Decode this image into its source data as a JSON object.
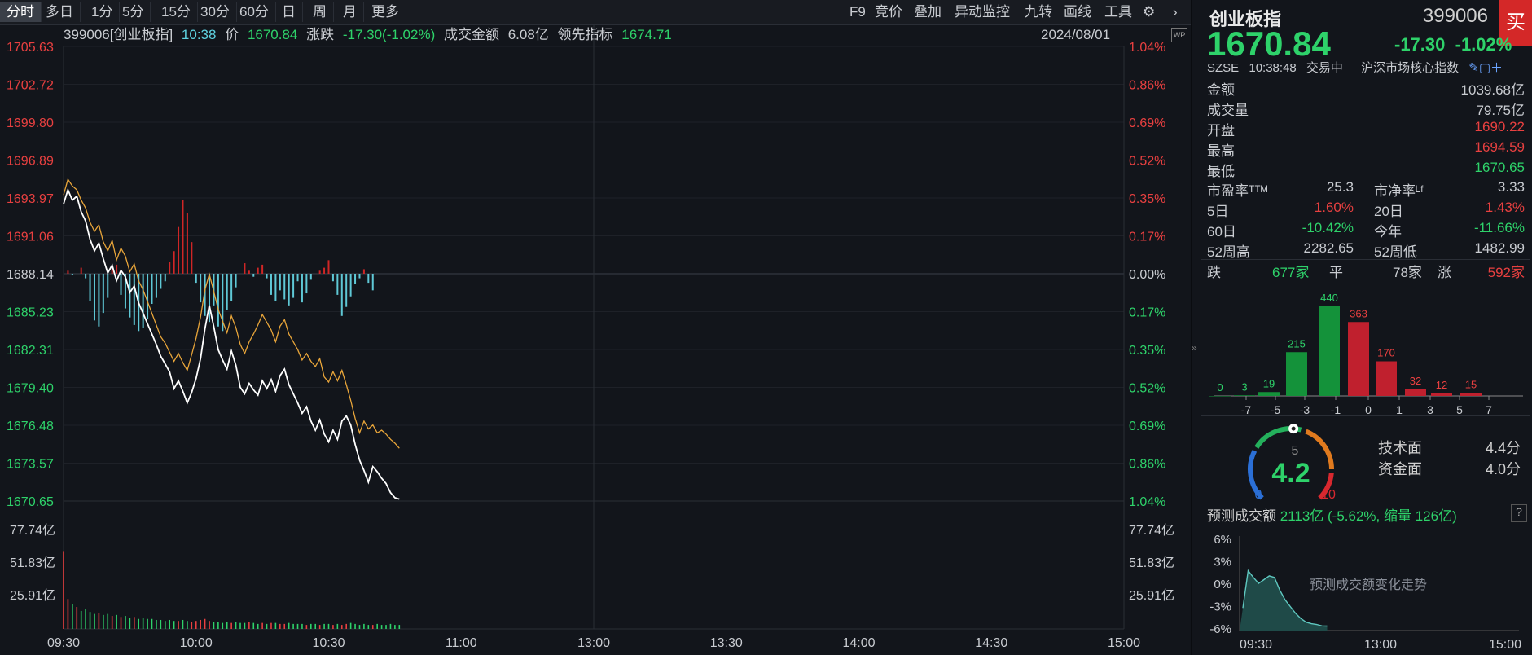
{
  "tabs": [
    "分时",
    "多日",
    "1分",
    "5分",
    "15分",
    "30分",
    "60分",
    "日",
    "周",
    "月",
    "更多"
  ],
  "tools": [
    "F9",
    "竞价",
    "叠加",
    "异动监控",
    "九转",
    "画线",
    "工具"
  ],
  "info": {
    "code": "399006[创业板指]",
    "time": "10:38",
    "price_label": "价",
    "price": "1670.84",
    "change_label": "涨跌",
    "change": "-17.30(-1.02%)",
    "amount_label": "成交金额",
    "amount": "6.08亿",
    "lead_label": "领先指标",
    "lead": "1674.71",
    "date": "2024/08/01",
    "wp_icon": "WP"
  },
  "chart_data": {
    "type": "line",
    "price_ticks": [
      "1705.63",
      "1702.72",
      "1699.80",
      "1696.89",
      "1693.97",
      "1691.06",
      "1688.14",
      "1685.23",
      "1682.31",
      "1679.40",
      "1676.48",
      "1673.57",
      "1670.65"
    ],
    "pct_ticks": [
      "1.04%",
      "0.86%",
      "0.69%",
      "0.52%",
      "0.35%",
      "0.17%",
      "0.00%",
      "0.17%",
      "0.35%",
      "0.52%",
      "0.69%",
      "0.86%",
      "1.04%"
    ],
    "vol_ticks": [
      "77.74亿",
      "51.83亿",
      "25.91亿"
    ],
    "time_ticks": [
      "09:30",
      "10:00",
      "10:30",
      "11:00",
      "13:00",
      "13:30",
      "14:00",
      "14:30",
      "15:00"
    ],
    "ylim": [
      1670.65,
      1705.63
    ],
    "prev_close": 1688.14,
    "price": [
      1693.5,
      1694.6,
      1693.8,
      1694.1,
      1692.9,
      1692.2,
      1690.8,
      1689.9,
      1690.5,
      1689.3,
      1688.2,
      1688.8,
      1687.6,
      1688.4,
      1687.9,
      1686.7,
      1687.2,
      1685.9,
      1685.1,
      1684.3,
      1683.5,
      1682.7,
      1681.8,
      1681.2,
      1680.6,
      1679.3,
      1679.9,
      1679.1,
      1678.2,
      1679.0,
      1680.1,
      1681.6,
      1683.9,
      1685.7,
      1684.1,
      1682.3,
      1681.5,
      1680.8,
      1682.2,
      1681.1,
      1679.4,
      1678.9,
      1679.7,
      1679.2,
      1678.8,
      1679.9,
      1679.3,
      1680.0,
      1679.1,
      1680.3,
      1680.8,
      1679.6,
      1678.9,
      1678.2,
      1677.4,
      1677.9,
      1676.8,
      1676.1,
      1676.9,
      1675.8,
      1675.2,
      1676.1,
      1675.4,
      1676.8,
      1677.2,
      1676.5,
      1675.0,
      1673.8,
      1673.0,
      1672.1,
      1673.3,
      1672.9,
      1672.4,
      1672.0,
      1671.3,
      1670.9,
      1670.8
    ],
    "lead": [
      1694.2,
      1695.4,
      1694.9,
      1694.6,
      1693.8,
      1693.2,
      1692.1,
      1691.4,
      1691.9,
      1690.6,
      1689.9,
      1690.7,
      1689.2,
      1690.1,
      1689.5,
      1688.3,
      1688.9,
      1687.6,
      1686.9,
      1686.0,
      1685.1,
      1684.2,
      1683.3,
      1682.8,
      1682.1,
      1681.4,
      1682.0,
      1681.3,
      1680.7,
      1681.9,
      1683.2,
      1684.8,
      1686.9,
      1688.1,
      1686.8,
      1685.4,
      1684.5,
      1683.6,
      1684.9,
      1684.0,
      1682.7,
      1682.0,
      1682.9,
      1683.5,
      1684.2,
      1685.0,
      1684.4,
      1683.8,
      1682.9,
      1684.1,
      1684.6,
      1683.5,
      1682.9,
      1682.3,
      1681.5,
      1682.0,
      1681.4,
      1681.0,
      1681.6,
      1680.2,
      1679.8,
      1680.6,
      1679.9,
      1680.7,
      1679.6,
      1678.4,
      1677.0,
      1675.9,
      1676.8,
      1676.2,
      1676.5,
      1675.9,
      1676.1,
      1675.8,
      1675.4,
      1675.1,
      1674.71
    ],
    "bars": [
      0.2,
      -0.1,
      0,
      0.4,
      -0.3,
      -1.8,
      -3.1,
      -3.5,
      -2.6,
      -1.6,
      0.3,
      0.6,
      -1.4,
      -2.3,
      -2.9,
      -3.4,
      -3.8,
      -3.6,
      -3.0,
      -2.0,
      -1.6,
      -1.0,
      -0.5,
      0.8,
      1.5,
      3.1,
      4.9,
      4.0,
      2.1,
      -0.6,
      -1.9,
      -2.8,
      -3.2,
      -2.1,
      -3.5,
      -3.8,
      -2.4,
      -1.8,
      -0.9,
      0,
      0.7,
      0.2,
      -0.2,
      0.4,
      0.6,
      -0.3,
      -1.4,
      -1.8,
      -1.1,
      -1.7,
      -2.1,
      -1.6,
      -0.5,
      -1.9,
      -1.3,
      -0.4,
      0,
      0.2,
      0.4,
      0.9,
      -0.5,
      -1.4,
      -2.8,
      -2.2,
      -1.5,
      -0.7,
      -0.3,
      0.3,
      -0.6,
      -1.1
    ],
    "volumes": [
      78,
      30,
      25,
      22,
      18,
      20,
      17,
      15,
      16,
      14,
      15,
      13,
      14,
      12,
      13,
      11,
      12,
      10,
      11,
      10,
      10,
      9,
      9,
      8,
      9,
      8,
      8,
      9,
      8,
      7,
      8,
      9,
      10,
      8,
      7,
      7,
      6,
      7,
      6,
      7,
      6,
      6,
      7,
      6,
      5,
      6,
      5,
      6,
      6,
      5,
      5,
      6,
      5,
      5,
      5,
      4,
      5,
      5,
      4,
      5,
      5,
      4,
      5,
      4,
      5,
      6,
      5,
      4,
      5,
      4,
      4,
      5,
      4,
      4,
      5,
      4,
      4
    ],
    "vol_max": 103.65
  },
  "panel": {
    "name": "创业板指",
    "code": "399006",
    "buy": "买",
    "price": "1670.84",
    "change": "-17.30",
    "pct": "-1.02%",
    "exchange": "SZSE",
    "time": "10:38:48",
    "status": "交易中",
    "desc": "沪深市场核心指数",
    "stats": [
      {
        "k": "金额",
        "v": "1039.68亿",
        "c": "w"
      },
      {
        "k": "成交量",
        "v": "79.75亿",
        "c": "w"
      },
      {
        "k": "开盘",
        "v": "1690.22",
        "c": "rd"
      },
      {
        "k": "最高",
        "v": "1694.59",
        "c": "rd"
      },
      {
        "k": "最低",
        "v": "1670.65",
        "c": "gr"
      }
    ],
    "pairs": [
      {
        "k1": "市盈率ᵀᵀᴹ",
        "v1": "25.3",
        "c1": "w",
        "k2": "市净率ᴸᶠ",
        "v2": "3.33",
        "c2": "w"
      },
      {
        "k1": "5日",
        "v1": "1.60%",
        "c1": "rd",
        "k2": "20日",
        "v2": "1.43%",
        "c2": "rd"
      },
      {
        "k1": "60日",
        "v1": "-10.42%",
        "c1": "gr",
        "k2": "今年",
        "v2": "-11.66%",
        "c2": "gr"
      },
      {
        "k1": "52周高",
        "v1": "2282.65",
        "c1": "w",
        "k2": "52周低",
        "v2": "1482.99",
        "c2": "w"
      }
    ],
    "breadth": {
      "down_label": "跌",
      "down": "677家",
      "flat_label": "平",
      "flat": "78家",
      "up_label": "涨",
      "up": "592家"
    }
  },
  "dist": {
    "labels": [
      "-7",
      "-5",
      "-3",
      "-1",
      "0",
      "1",
      "3",
      "5",
      "7"
    ],
    "counts": [
      0,
      3,
      19,
      215,
      440,
      363,
      170,
      32,
      12,
      15
    ],
    "colors": [
      "g",
      "g",
      "g",
      "g",
      "g",
      "r",
      "r",
      "r",
      "r",
      "r"
    ]
  },
  "gauge": {
    "value": "4.2",
    "min": "0",
    "mid": "5",
    "max": "10",
    "tech_label": "技术面",
    "tech": "4.4分",
    "fund_label": "资金面",
    "fund": "4.0分"
  },
  "pred": {
    "label": "预测成交额",
    "value": "2113亿 (-5.62%, 缩量 126亿)",
    "ticks": [
      "6%",
      "3%",
      "0%",
      "-3%",
      "-6%"
    ],
    "times": [
      "09:30",
      "13:00",
      "15:00"
    ],
    "note": "预测成交额变化走势",
    "series": [
      -3.2,
      1.8,
      0.9,
      0.1,
      0.6,
      1.1,
      0.9,
      -0.8,
      -2.1,
      -3.0,
      -3.9,
      -4.6,
      -5.1,
      -5.3,
      -5.4,
      -5.6,
      -5.62
    ]
  },
  "colors": {
    "up": "#e84040",
    "down": "#2ed26a",
    "price_line": "#ffffff",
    "lead_line": "#e8a53a",
    "bar_down": "#5fc8d6",
    "grid": "#2a2e36"
  }
}
